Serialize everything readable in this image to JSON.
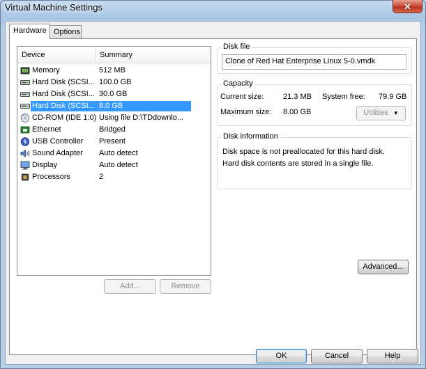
{
  "window": {
    "title": "Virtual Machine Settings",
    "close_glyph": "✕"
  },
  "tabs": [
    {
      "label": "Hardware",
      "active": true
    },
    {
      "label": "Options",
      "active": false
    }
  ],
  "device_list": {
    "headers": {
      "device": "Device",
      "summary": "Summary"
    },
    "rows": [
      {
        "icon": "memory-icon",
        "device": "Memory",
        "summary": "512 MB"
      },
      {
        "icon": "hard-disk-icon",
        "device": "Hard Disk (SCSI...",
        "summary": "100.0 GB"
      },
      {
        "icon": "hard-disk-icon",
        "device": "Hard Disk (SCSI...",
        "summary": "30.0 GB"
      },
      {
        "icon": "hard-disk-icon",
        "device": "Hard Disk (SCSI...",
        "summary": "8.0 GB",
        "selected": true
      },
      {
        "icon": "cd-rom-icon",
        "device": "CD-ROM (IDE 1:0)",
        "summary": "Using file D:\\TDdownlo..."
      },
      {
        "icon": "ethernet-icon",
        "device": "Ethernet",
        "summary": "Bridged"
      },
      {
        "icon": "usb-icon",
        "device": "USB Controller",
        "summary": "Present"
      },
      {
        "icon": "speaker-icon",
        "device": "Sound Adapter",
        "summary": "Auto detect"
      },
      {
        "icon": "display-icon",
        "device": "Display",
        "summary": "Auto detect"
      },
      {
        "icon": "processor-icon",
        "device": "Processors",
        "summary": "2"
      }
    ]
  },
  "list_buttons": {
    "add": "Add...",
    "remove": "Remove"
  },
  "disk_file": {
    "title": "Disk file",
    "value": "Clone of Red Hat Enterprise Linux 5-0.vmdk"
  },
  "capacity": {
    "title": "Capacity",
    "current_size_label": "Current size:",
    "current_size_value": "21.3 MB",
    "system_free_label": "System free:",
    "system_free_value": "79.9 GB",
    "maximum_size_label": "Maximum size:",
    "maximum_size_value": "8.00 GB",
    "utilities_label": "Utilities",
    "utilities_arrow": "▼"
  },
  "disk_information": {
    "title": "Disk information",
    "line1": "Disk space is not preallocated for this hard disk.",
    "line2": "Hard disk contents are stored in a single file."
  },
  "advanced_label": "Advanced...",
  "footer": {
    "ok": "OK",
    "cancel": "Cancel",
    "help": "Help"
  }
}
